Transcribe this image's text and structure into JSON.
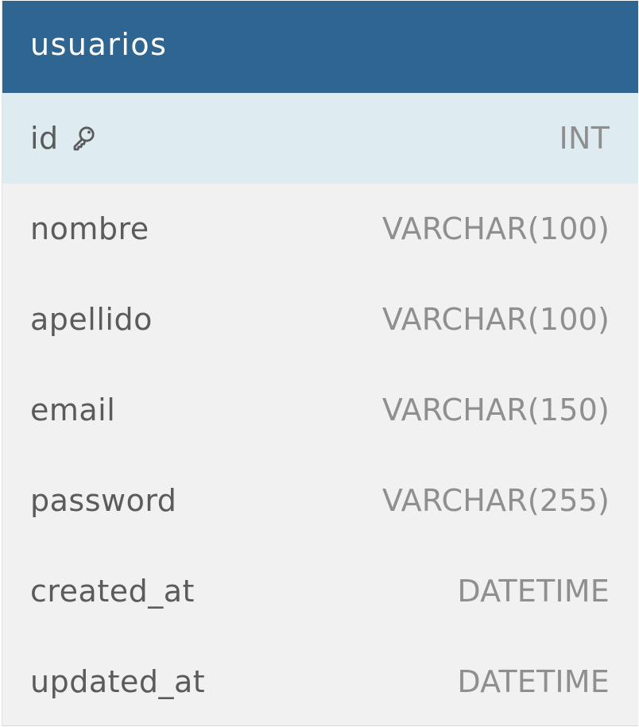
{
  "table": {
    "name": "usuarios",
    "header_color": "#2f6591",
    "primary_key_highlight": "#deebf1",
    "columns": [
      {
        "name": "id",
        "type": "INT",
        "primary_key": true,
        "icon": "key-icon"
      },
      {
        "name": "nombre",
        "type": "VARCHAR(100)"
      },
      {
        "name": "apellido",
        "type": "VARCHAR(100)"
      },
      {
        "name": "email",
        "type": "VARCHAR(150)"
      },
      {
        "name": "password",
        "type": "VARCHAR(255)"
      },
      {
        "name": "created_at",
        "type": "DATETIME"
      },
      {
        "name": "updated_at",
        "type": "DATETIME"
      }
    ]
  }
}
